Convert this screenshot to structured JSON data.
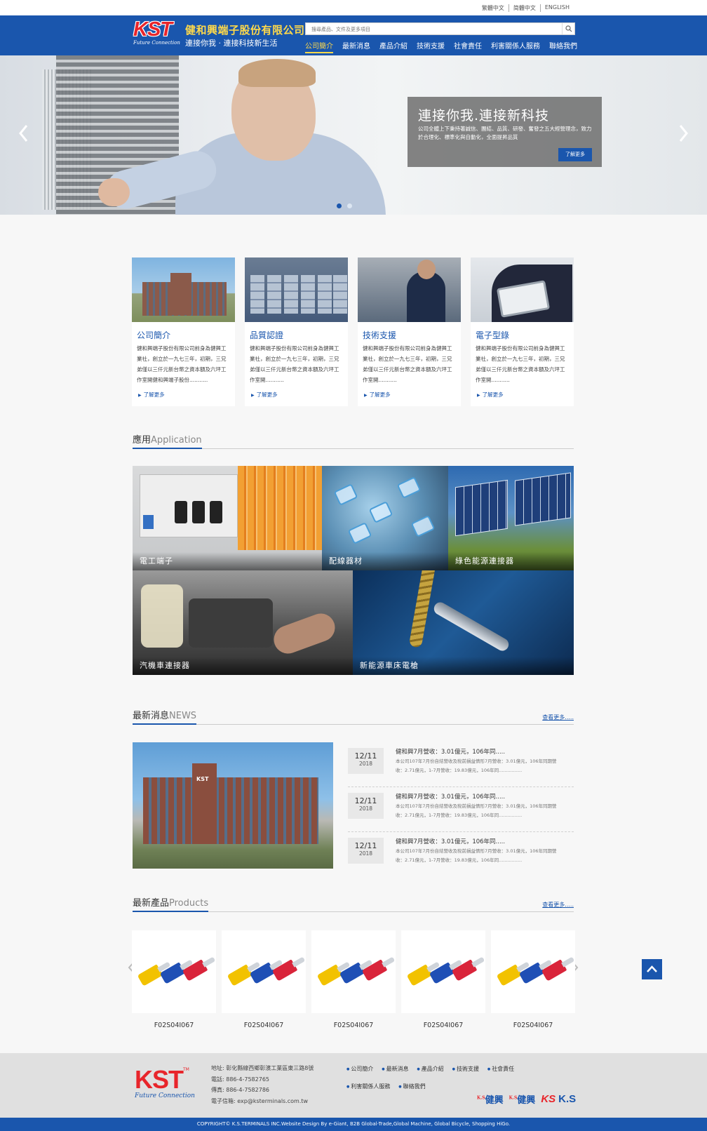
{
  "lang_switch": [
    "繁體中文",
    "简體中文",
    "ENGLISH"
  ],
  "brand": {
    "logo_text": "KST",
    "logo_tagline": "Future Connection",
    "company_name": "健和興端子股份有限公司",
    "slogan": "連接你我 · 連接科技新生活"
  },
  "search": {
    "placeholder": "搜尋產品、文件及更多項目"
  },
  "nav": [
    "公司簡介",
    "最新消息",
    "產品介紹",
    "技術支援",
    "社會責任",
    "利害關係人服務",
    "聯絡我們"
  ],
  "hero": {
    "title": "連接你我.連接新科技",
    "desc": "公司全體上下秉持著誠信、團結、品質、研發、奮發之五大經營理念，致力於合理化、標準化與自動化，全面提昇品質",
    "button": "了解更多",
    "slide_count": 2,
    "active_slide": 1
  },
  "cards": [
    {
      "title": "公司簡介",
      "text": "健和興端子股份有限公司前身為健興工業社，創立於一九七三年，初期，三兄弟僅以三仟元新台幣之資本額及六坪工作室開健和興端子股份...........",
      "more": "了解更多"
    },
    {
      "title": "品質認證",
      "text": "健和興端子股份有限公司前身為健興工業社，創立於一九七三年，初期，三兄弟僅以三仟元新台幣之資本額及六坪工作室開...........",
      "more": "了解更多"
    },
    {
      "title": "技術支援",
      "text": "健和興端子股份有限公司前身為健興工業社，創立於一九七三年，初期，三兄弟僅以三仟元新台幣之資本額及六坪工作室開...........",
      "more": "了解更多"
    },
    {
      "title": "電子型錄",
      "text": "健和興端子股份有限公司前身為健興工業社，創立於一九七三年，初期，三兄弟僅以三仟元新台幣之資本額及六坪工作室開...........",
      "more": "了解更多"
    }
  ],
  "application": {
    "heading": "應用",
    "heading_en": "Application",
    "items": [
      "電工端子",
      "配線器材",
      "綠色能源連接器",
      "汽機車連接器",
      "新能源車床電槍"
    ]
  },
  "news": {
    "heading": "最新消息",
    "heading_en": "NEWS",
    "more": "查看更多.....",
    "building_sign": "KST",
    "items": [
      {
        "day": "12/11",
        "year": "2018",
        "title": "健和興7月營收：3.01億元，106年同.....",
        "desc": "本公司107年7月份自結營收及稅前損益情形7月營收：3.01億元，106年同期營收：2.71億元，1-7月營收：19.83億元，106年同................"
      },
      {
        "day": "12/11",
        "year": "2018",
        "title": "健和興7月營收：3.01億元，106年同.....",
        "desc": "本公司107年7月份自結營收及稅前損益情形7月營收：3.01億元，106年同期營收：2.71億元，1-7月營收：19.83億元，106年同................"
      },
      {
        "day": "12/11",
        "year": "2018",
        "title": "健和興7月營收：3.01億元，106年同.....",
        "desc": "本公司107年7月份自結營收及稅前損益情形7月營收：3.01億元，106年同期營收：2.71億元，1-7月營收：19.83億元，106年同................"
      }
    ]
  },
  "products": {
    "heading": "最新產品",
    "heading_en": "Products",
    "more": "查看更多.....",
    "items": [
      "F02S04I067",
      "F02S04I067",
      "F02S04I067",
      "F02S04I067",
      "F02S04I067"
    ]
  },
  "footer": {
    "logo_text": "KST",
    "logo_tm": "TM",
    "logo_tagline": "Future Connection",
    "address": "地址: 彰化縣線西鄉彰濱工業區東三路8號",
    "phone": "電話: 886-4-7582765",
    "fax": "傳真: 886-4-7582786",
    "email": "電子信箱: exp@ksterminals.com.tw",
    "links": [
      "公司簡介",
      "最新消息",
      "產品介紹",
      "技術支援",
      "社會責任",
      "利害關係人服務",
      "聯絡我們"
    ],
    "brands": [
      "健興",
      "健興",
      "KS",
      "K.S"
    ],
    "brand_small": [
      "K.S",
      "K.S"
    ]
  },
  "copyright": "COPYRIGHT© K.S.TERMINALS INC.Website Design By e-Giant, B2B Global-Trade,Global Machine, Global Bicycle, Shopping HiGo.",
  "colors": {
    "brand_blue": "#1a56ad",
    "brand_red": "#e8252b",
    "accent_yellow": "#ffd94a"
  }
}
